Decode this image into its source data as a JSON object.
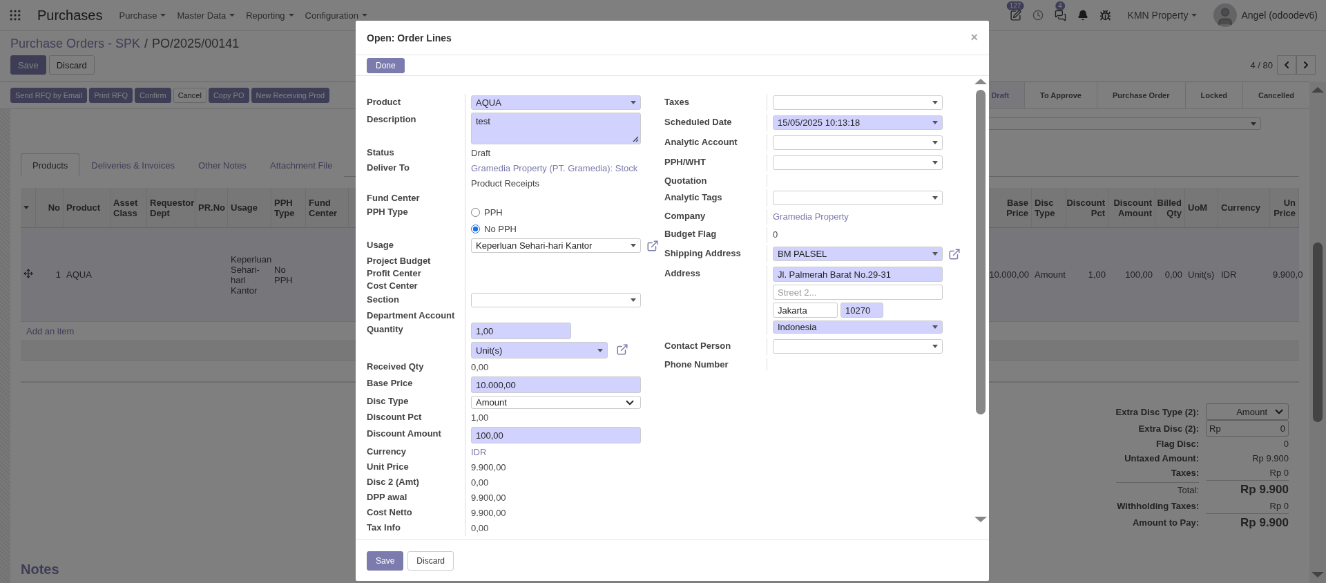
{
  "navbar": {
    "app": "Purchases",
    "menus": [
      "Purchase",
      "Master Data",
      "Reporting",
      "Configuration"
    ],
    "activity_count": "127",
    "message_count": "4",
    "company": "KMN Property",
    "user": "Angel (odoodev6)"
  },
  "breadcrumb": {
    "parent": "Purchase Orders - SPK",
    "separator": "/",
    "current": "PO/2025/00141"
  },
  "form_buttons": [
    {
      "label": "Save",
      "primary": true
    },
    {
      "label": "Discard",
      "primary": false
    }
  ],
  "pager": "4 / 80",
  "actions": [
    {
      "label": "Send RFQ by Email",
      "primary": true
    },
    {
      "label": "Print RFQ",
      "primary": true
    },
    {
      "label": "Confirm",
      "primary": true
    },
    {
      "label": "Cancel",
      "primary": false
    },
    {
      "label": "Copy PO",
      "primary": true
    },
    {
      "label": "New Receiving Prod",
      "primary": true
    }
  ],
  "stages": [
    {
      "label": "Draft",
      "selected": true
    },
    {
      "label": "To Approve",
      "selected": false
    },
    {
      "label": "Purchase Order",
      "selected": false
    },
    {
      "label": "Locked",
      "selected": false
    },
    {
      "label": "Cancelled",
      "selected": false
    }
  ],
  "tabs": [
    {
      "label": "Products",
      "selected": true
    },
    {
      "label": "Deliveries & Invoices",
      "selected": false
    },
    {
      "label": "Other Notes",
      "selected": false
    },
    {
      "label": "Attachment File",
      "selected": false
    }
  ],
  "order_lines": {
    "columns_left": [
      {
        "label": "No",
        "numeric": true
      },
      {
        "label": "Product",
        "numeric": false
      },
      {
        "label": "Asset Class",
        "numeric": false
      },
      {
        "label": "Requestor Dept",
        "numeric": false
      },
      {
        "label": "PR.No",
        "numeric": false
      },
      {
        "label": "Usage",
        "numeric": false
      },
      {
        "label": "PPH Type",
        "numeric": false
      },
      {
        "label": "Fund Center",
        "numeric": false
      }
    ],
    "columns_right": [
      {
        "label": "Base Price",
        "numeric": true
      },
      {
        "label": "Disc Type",
        "numeric": false
      },
      {
        "label": "Discount Pct",
        "numeric": true
      },
      {
        "label": "Discount Amount",
        "numeric": true
      },
      {
        "label": "Billed Qty",
        "numeric": true
      },
      {
        "label": "UoM",
        "numeric": false
      },
      {
        "label": "Currency",
        "numeric": false
      },
      {
        "label": "Un Price",
        "numeric": true
      }
    ],
    "rows": [
      {
        "selected": true,
        "left_cells": [
          "1",
          "AQUA",
          null,
          null,
          null,
          "Keperluan Sehari-hari Kantor",
          "No PPH",
          null
        ],
        "right_cells": [
          "10.000,00",
          "Amount",
          "1,00",
          "100,00",
          "0,00",
          "Unit(s)",
          "IDR",
          "9.900,0"
        ]
      }
    ],
    "add_item": "Add an item"
  },
  "totals": {
    "extra_disc_type": {
      "label": "Extra Disc Type (2):",
      "value": "Amount"
    },
    "extra_disc": {
      "label": "Extra Disc (2):",
      "currency": "Rp",
      "value": "0"
    },
    "lines": [
      {
        "label": "Flag Disc:",
        "value": "0",
        "kind": "line"
      },
      {
        "label": "Untaxed Amount:",
        "value": "Rp 9.900",
        "kind": "line"
      },
      {
        "label": "Taxes:",
        "value": "Rp 0",
        "kind": "line"
      },
      {
        "label": "Total:",
        "value": "Rp 9.900",
        "kind": "total"
      },
      {
        "label": "Withholding Taxes:",
        "value": "Rp 0",
        "kind": "line"
      },
      {
        "label": "Amount to Pay:",
        "value": "Rp 9.900",
        "kind": "grand"
      }
    ]
  },
  "notes": {
    "title": "Notes"
  },
  "dialog": {
    "title": "Open: Order Lines",
    "close": "×",
    "done": "Done",
    "left_fields": [
      {
        "label": "Product",
        "kind": "select",
        "value": "AQUA",
        "required": true
      },
      {
        "label": "Description",
        "kind": "textarea",
        "value": "test",
        "required": true
      },
      {
        "label": "Status",
        "kind": "text",
        "value": "Draft"
      },
      {
        "label": "Deliver To",
        "kind": "link",
        "value": "Gramedia Property (PT. Gramedia): Stock",
        "note": "Product Receipts"
      },
      {
        "label": "Fund Center",
        "kind": "empty"
      },
      {
        "label": "PPH Type",
        "kind": "radio",
        "options": [
          {
            "label": "PPH",
            "selected": false
          },
          {
            "label": "No PPH",
            "selected": true
          }
        ]
      },
      {
        "label": "Usage",
        "kind": "select",
        "value": "Keperluan Sehari-hari Kantor",
        "required": false,
        "external": true
      },
      {
        "label": "Project Budget",
        "kind": "empty"
      },
      {
        "label": "Profit Center",
        "kind": "empty"
      },
      {
        "label": "Cost Center",
        "kind": "empty"
      },
      {
        "label": "Section",
        "kind": "select",
        "required": false
      },
      {
        "label": "Department Account",
        "kind": "empty"
      },
      {
        "label": "Quantity",
        "kind": "quantity",
        "value": "1,00",
        "uom": "Unit(s)",
        "required": true,
        "external": true
      },
      {
        "label": "Received Qty",
        "kind": "text",
        "value": "0,00"
      },
      {
        "label": "Base Price",
        "kind": "input",
        "value": "10.000,00",
        "required": true
      },
      {
        "label": "Disc Type",
        "kind": "dropdown",
        "value": "Amount"
      },
      {
        "label": "Discount Pct",
        "kind": "text",
        "value": "1,00"
      },
      {
        "label": "Discount Amount",
        "kind": "input",
        "value": "100,00",
        "required": true
      },
      {
        "label": "Currency",
        "kind": "link",
        "value": "IDR"
      },
      {
        "label": "Unit Price",
        "kind": "text",
        "value": "9.900,00"
      },
      {
        "label": "Disc 2 (Amt)",
        "kind": "text",
        "value": "0,00"
      },
      {
        "label": "DPP awal",
        "kind": "text",
        "value": "9.900,00"
      },
      {
        "label": "Cost Netto",
        "kind": "text",
        "value": "9.900,00"
      },
      {
        "label": "Tax Info",
        "kind": "text",
        "value": "0,00"
      }
    ],
    "right_fields": [
      {
        "label": "Taxes",
        "kind": "select",
        "required": false
      },
      {
        "label": "Scheduled Date",
        "kind": "select",
        "value": "15/05/2025 10:13:18",
        "required": true
      },
      {
        "label": "Analytic Account",
        "kind": "select",
        "required": false
      },
      {
        "label": "PPH/WHT",
        "kind": "select",
        "required": false
      },
      {
        "label": "Quotation",
        "kind": "empty"
      },
      {
        "label": "Analytic Tags",
        "kind": "select",
        "required": false
      },
      {
        "label": "Company",
        "kind": "link",
        "value": "Gramedia Property"
      },
      {
        "label": "Budget Flag",
        "kind": "text",
        "value": "0"
      },
      {
        "label": "Shipping Address",
        "kind": "select",
        "value": "BM PALSEL",
        "required": true,
        "external": true
      },
      {
        "label": "Address",
        "kind": "address",
        "street": {
          "value": "Jl. Palmerah Barat No.29-31",
          "required": true
        },
        "street2": {
          "placeholder": "Street 2..."
        },
        "city": {
          "value": "Jakarta",
          "required": false
        },
        "zip": {
          "value": "10270",
          "required": true
        },
        "country": {
          "value": "Indonesia",
          "required": true
        }
      },
      {
        "label": "Contact Person",
        "kind": "select",
        "required": false
      },
      {
        "label": "Phone Number",
        "kind": "empty"
      }
    ],
    "footer": [
      {
        "label": "Save",
        "primary": true
      },
      {
        "label": "Discard",
        "primary": false
      }
    ]
  }
}
